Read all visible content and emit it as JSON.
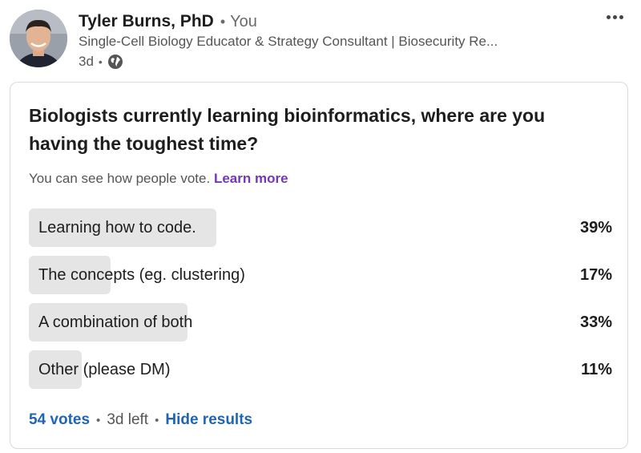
{
  "post": {
    "author_name": "Tyler Burns, PhD",
    "separator": "•",
    "relation": "You",
    "headline": "Single-Cell Biology Educator & Strategy Consultant | Biosecurity Re...",
    "time_posted": "3d",
    "meta_separator": "•",
    "visibility_icon": "globe-icon",
    "menu_icon": "more-options-icon"
  },
  "poll": {
    "question": "Biologists currently learning bioinformatics, where are you having the toughest time?",
    "visibility_note": "You can see how people vote.",
    "learn_more": "Learn more",
    "options": [
      {
        "label": "Learning how to code.",
        "percent_label": "39%",
        "percent": 39
      },
      {
        "label": "The concepts (eg. clustering)",
        "percent_label": "17%",
        "percent": 17
      },
      {
        "label": "A combination of both",
        "percent_label": "33%",
        "percent": 33
      },
      {
        "label": "Other (please DM)",
        "percent_label": "11%",
        "percent": 11
      }
    ],
    "votes": "54 votes",
    "footer_separator": "•",
    "time_left": "3d left",
    "hide_results": "Hide results"
  },
  "colors": {
    "bar_fill": "#e5e5e5",
    "link_blue": "#1f65b5",
    "link_purple": "#7437b8"
  }
}
